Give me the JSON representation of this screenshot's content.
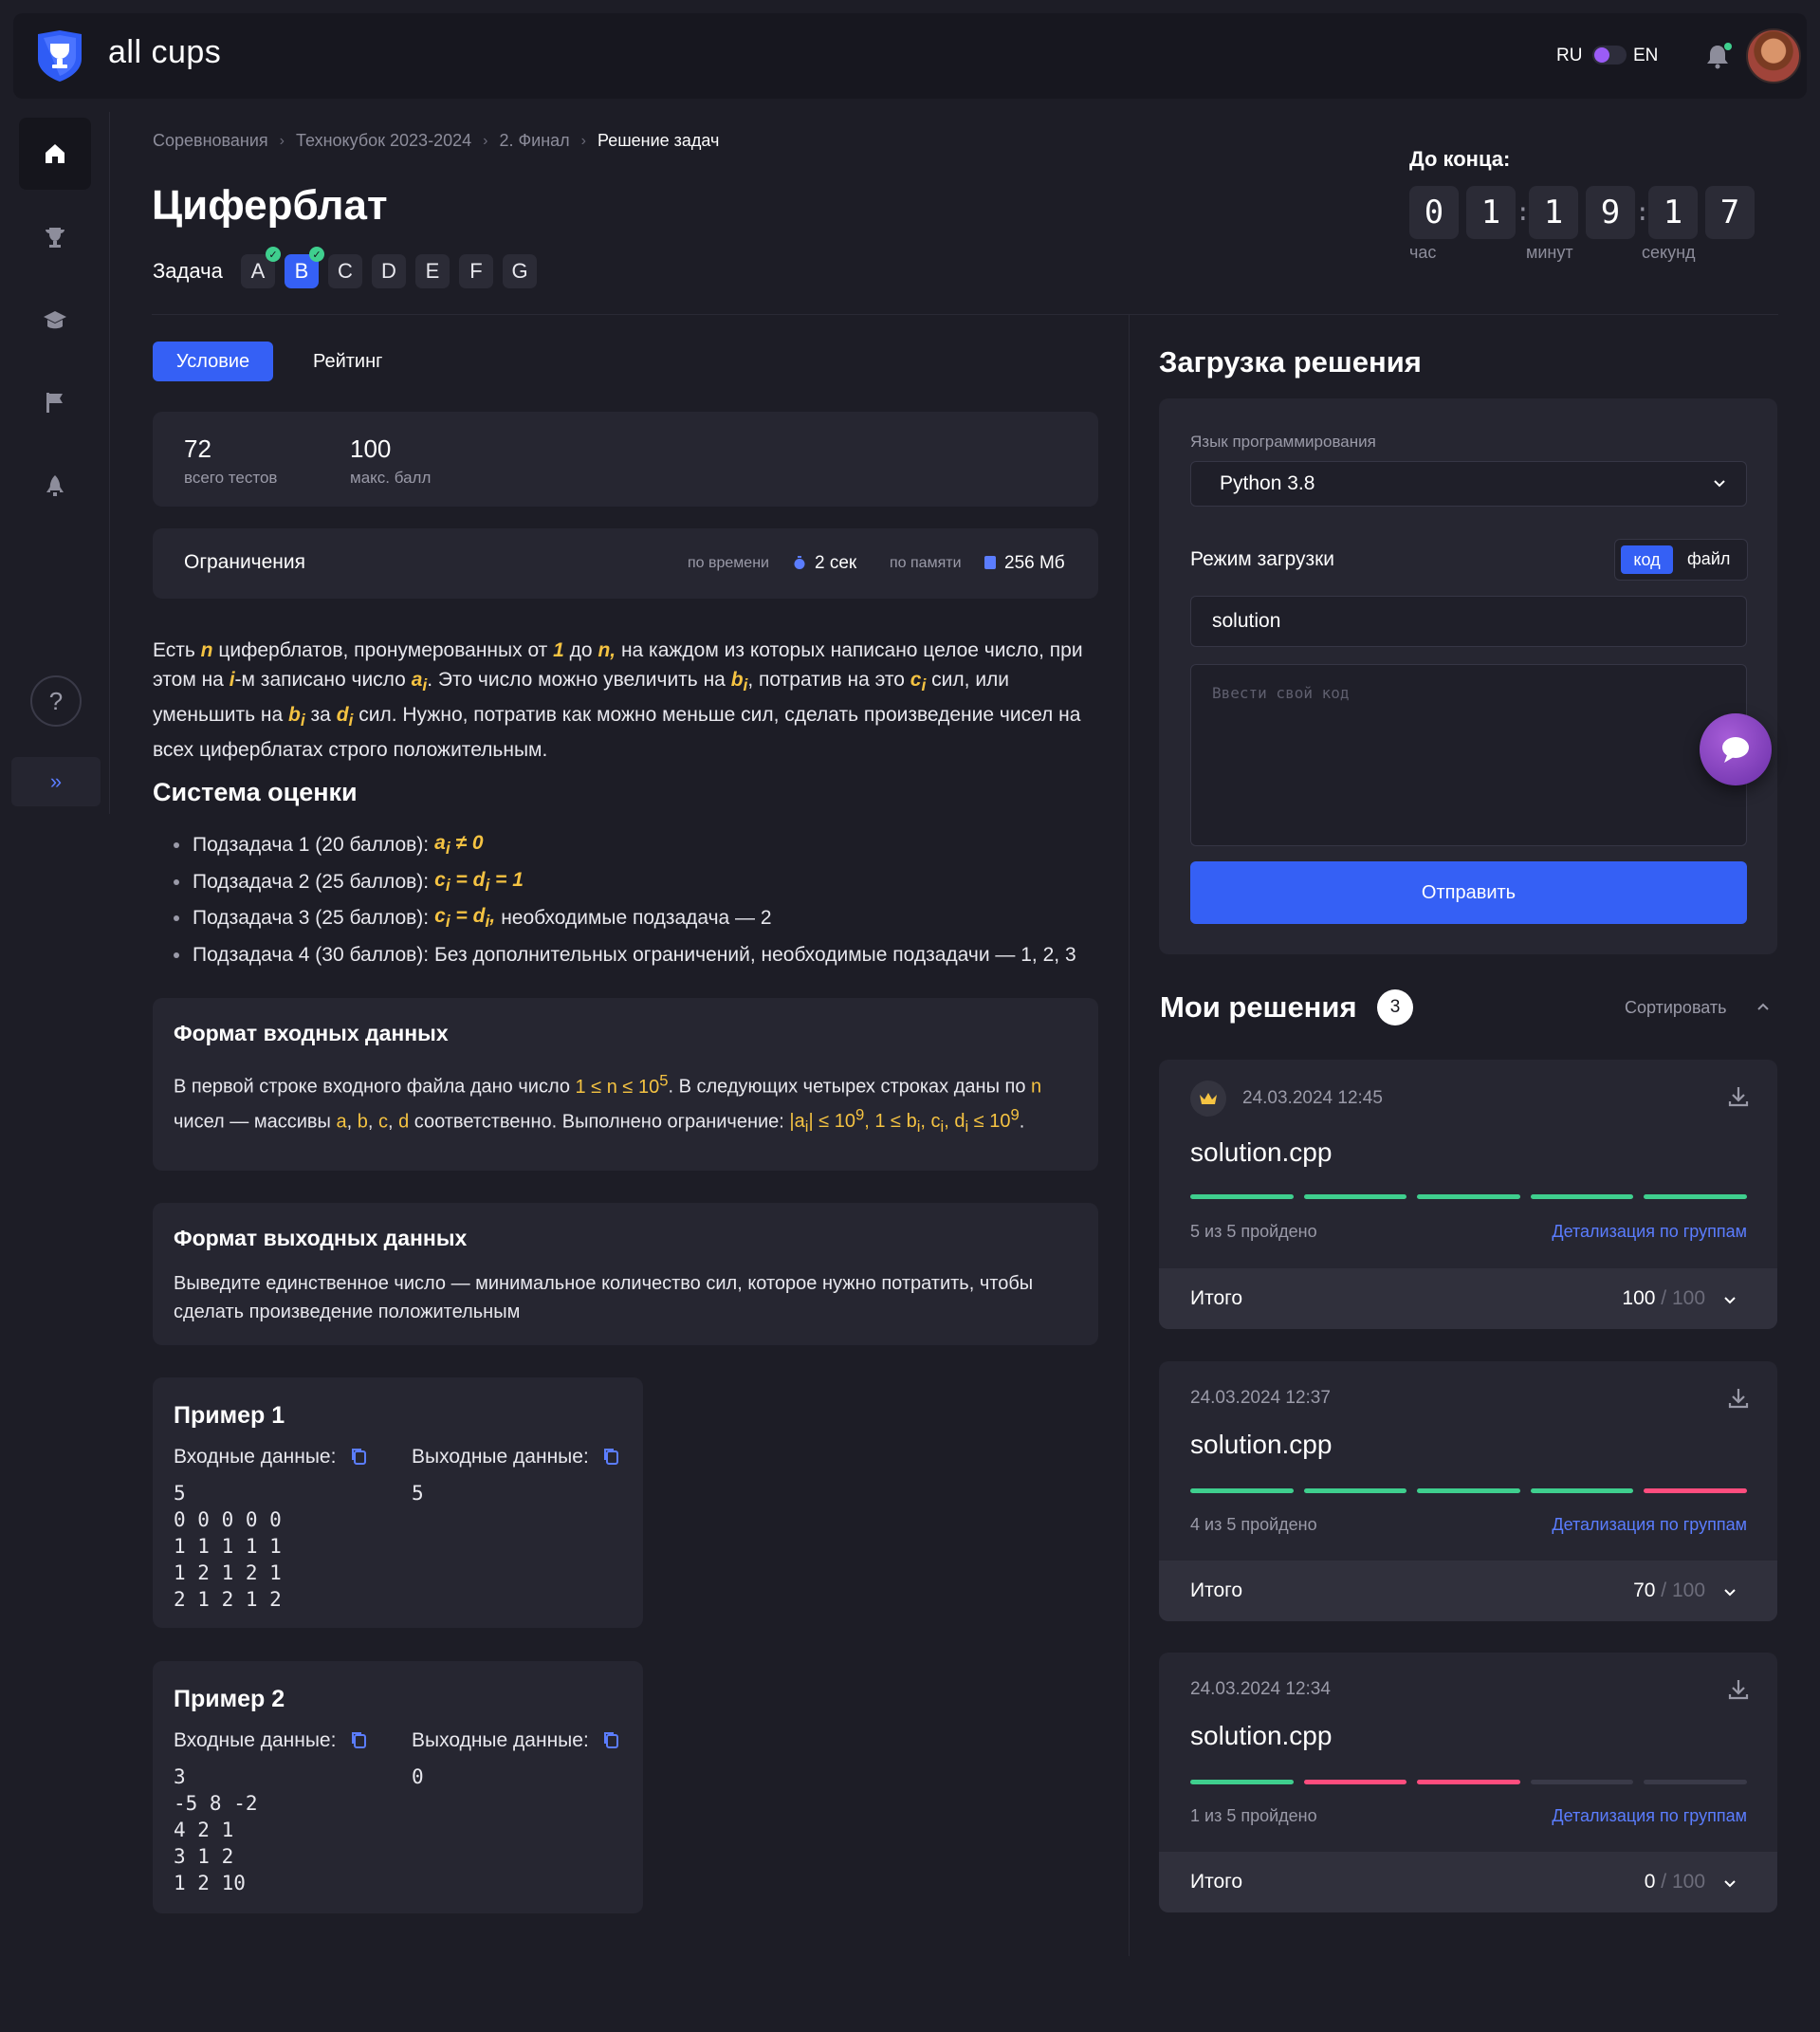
{
  "brand": {
    "name": "all cups"
  },
  "header": {
    "lang_ru": "RU",
    "lang_en": "EN"
  },
  "sidebar": {
    "items": [
      {
        "name": "home",
        "icon": "home-icon"
      },
      {
        "name": "trophy",
        "icon": "trophy-icon"
      },
      {
        "name": "education",
        "icon": "education-icon"
      },
      {
        "name": "flag",
        "icon": "flag-icon"
      },
      {
        "name": "rocket",
        "icon": "rocket-icon"
      }
    ],
    "help": "?",
    "expand": "»"
  },
  "breadcrumb": [
    "Соревнования",
    "Технокубок 2023-2024",
    "2. Финал",
    "Решение задач"
  ],
  "page": {
    "title": "Циферблат",
    "task_label": "Задача",
    "tasks": [
      {
        "letter": "A",
        "solved": true,
        "active": false
      },
      {
        "letter": "B",
        "solved": true,
        "active": true
      },
      {
        "letter": "C",
        "solved": false,
        "active": false
      },
      {
        "letter": "D",
        "solved": false,
        "active": false
      },
      {
        "letter": "E",
        "solved": false,
        "active": false
      },
      {
        "letter": "F",
        "solved": false,
        "active": false
      },
      {
        "letter": "G",
        "solved": false,
        "active": false
      }
    ]
  },
  "timer": {
    "title": "До конца:",
    "digits": [
      "0",
      "1",
      "1",
      "9",
      "1",
      "7"
    ],
    "labels": [
      "час",
      "минут",
      "секунд"
    ]
  },
  "tabs": {
    "condition": "Условие",
    "rating": "Рейтинг"
  },
  "stats": {
    "tests_value": "72",
    "tests_label": "всего тестов",
    "score_value": "100",
    "score_label": "макс. балл"
  },
  "limits": {
    "title": "Ограничения",
    "time_label": "по времени",
    "time_value": "2 сек",
    "memory_label": "по памяти",
    "memory_value": "256 Мб"
  },
  "statement": {
    "p1a": "Есть ",
    "n": "n",
    "p1b": " циферблатов, пронумерованных от ",
    "one": "1",
    "p1c": " до ",
    "n2": "n,",
    "p1d": " на каждом из которых написано целое число, при этом на ",
    "i": "i",
    "p1e": "-м записано число ",
    "ai": "a",
    "ai_sub": "i",
    "p1f": ". Это число можно увеличить на ",
    "bi": "b",
    "bi_sub": "i",
    "p1g": ", потратив на это ",
    "ci": "c",
    "ci_sub": "i",
    "p1h": " сил, или уменьшить на ",
    "bi2": "b",
    "bi2_sub": "i",
    "p1i": " за ",
    "di": "d",
    "di_sub": "i",
    "p1j": " сил. Нужно, потратив как можно меньше сил, сделать произведение чисел на всех циферблатах строго положительным."
  },
  "scoring": {
    "title": "Система оценки",
    "items": [
      {
        "text": "Подзадача 1 (20 баллов):",
        "formula": "a",
        "sub": "i",
        "rest": " ≠ 0",
        "tail": ""
      },
      {
        "text": "Подзадача 2 (25 баллов):",
        "formula": "c",
        "sub": "i",
        "rest": " = d",
        "sub2": "i",
        "rest2": " = 1",
        "tail": ""
      },
      {
        "text": "Подзадача 3 (25 баллов):",
        "formula": "c",
        "sub": "i",
        "rest": " = d",
        "sub2": "i",
        "rest2": ",",
        "tail": " необходимые подзадача — 2"
      },
      {
        "text": "Подзадача 4 (30 баллов): Без дополнительных ограничений, необходимые подзадачи — 1, 2, 3"
      }
    ]
  },
  "input_format": {
    "title": "Формат входных данных",
    "t1": "В первой строке входного файла дано число ",
    "f1": "1 ≤ n ≤ 10",
    "f1_sup": "5",
    "t2": ". В следующих четырех строках даны по ",
    "f2": "n",
    "t3": " чисел — массивы ",
    "f3": "a",
    "t3b": ", ",
    "f4": "b",
    "t3c": ", ",
    "f5": "c",
    "t3d": ", ",
    "f6": "d",
    "t4": " соответственно. Выполнено ограничение: ",
    "f7": "|a",
    "f7_sub": "i",
    "f7b": "| ≤ 10",
    "f7_sup": "9",
    "f8": ", 1 ≤ b",
    "f8_sub": "i",
    "f8b": ", c",
    "f8b_sub": "i",
    "f8c": ", d",
    "f8c_sub": "i",
    "f9": " ≤ 10",
    "f9_sup": "9",
    "t5": "."
  },
  "output_format": {
    "title": "Формат выходных данных",
    "text": "Выведите единственное число — минимальное количество сил, которое нужно потратить, чтобы сделать произведение положительным"
  },
  "examples": [
    {
      "title": "Пример 1",
      "input_label": "Входные данные:",
      "output_label": "Выходные данные:",
      "input": "5\n0 0 0 0 0\n1 1 1 1 1\n1 2 1 2 1\n2 1 2 1 2",
      "output": "5"
    },
    {
      "title": "Пример 2",
      "input_label": "Входные данные:",
      "output_label": "Выходные данные:",
      "input": "3\n-5 8 -2\n4 2 1\n3 1 2\n1 2 10",
      "output": "0"
    }
  ],
  "upload": {
    "title": "Загрузка решения",
    "lang_label": "Язык программирования",
    "lang_value": "Python 3.8",
    "mode_label": "Режим загрузки",
    "mode_code": "код",
    "mode_file": "файл",
    "filename": "solution",
    "code_placeholder": "Ввести свой код",
    "submit": "Отправить"
  },
  "my_solutions": {
    "title": "Мои решения",
    "count": "3",
    "sort_label": "Сортировать",
    "detail_label": "Детализация по группам",
    "total_label": "Итого",
    "items": [
      {
        "date": "24.03.2024 12:45",
        "name": "solution.cpp",
        "best": true,
        "results": [
          "pass",
          "pass",
          "pass",
          "pass",
          "pass"
        ],
        "passed": "5 из 5 пройдено",
        "score": "100",
        "max": " / 100"
      },
      {
        "date": "24.03.2024 12:37",
        "name": "solution.cpp",
        "best": false,
        "results": [
          "pass",
          "pass",
          "pass",
          "pass",
          "fail"
        ],
        "passed": "4 из 5 пройдено",
        "score": "70",
        "max": " / 100"
      },
      {
        "date": "24.03.2024 12:34",
        "name": "solution.cpp",
        "best": false,
        "results": [
          "pass",
          "fail",
          "fail",
          "none",
          "none"
        ],
        "passed": "1 из 5 пройдено",
        "score": "0",
        "max": " / 100"
      }
    ]
  },
  "colors": {
    "accent": "#3560f5",
    "pass": "#3fcf8e",
    "fail": "#ff4d7e",
    "highlight": "#f5c342",
    "link": "#5b7dff"
  }
}
